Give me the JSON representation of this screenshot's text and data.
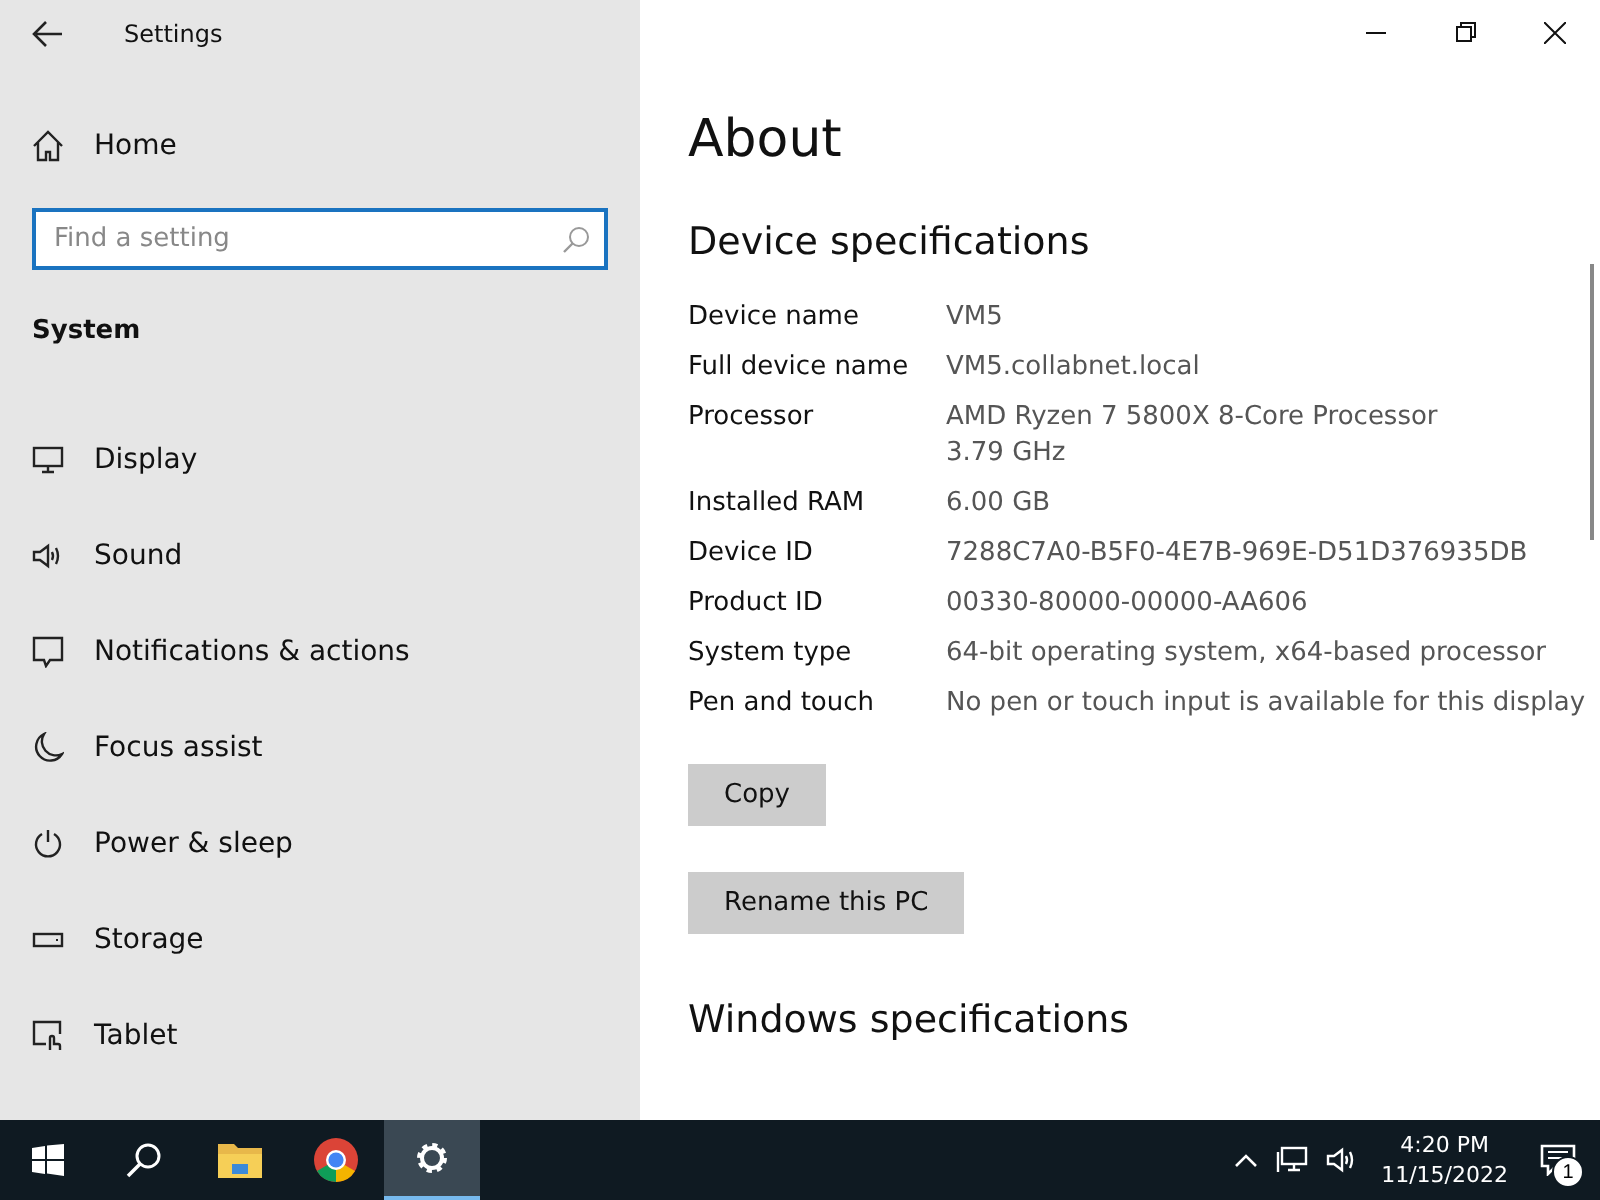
{
  "window": {
    "title": "Settings"
  },
  "sidebar": {
    "home": "Home",
    "search": {
      "placeholder": "Find a setting",
      "focused": true
    },
    "section": "System",
    "items": [
      {
        "label": "Display",
        "kind": "display"
      },
      {
        "label": "Sound",
        "kind": "sound"
      },
      {
        "label": "Notifications & actions",
        "kind": "notifications"
      },
      {
        "label": "Focus assist",
        "kind": "moon"
      },
      {
        "label": "Power & sleep",
        "kind": "power"
      },
      {
        "label": "Storage",
        "kind": "storage"
      },
      {
        "label": "Tablet",
        "kind": "tablet"
      }
    ]
  },
  "main": {
    "title": "About",
    "sections": [
      {
        "title": "Device specifications",
        "specs": [
          {
            "label": "Device name",
            "value": "VM5"
          },
          {
            "label": "Full device name",
            "value": "VM5.collabnet.local"
          },
          {
            "label": "Processor",
            "value": "AMD Ryzen 7 5800X 8-Core Processor",
            "value_2": "3.79 GHz"
          },
          {
            "label": "Installed RAM",
            "value": "6.00 GB"
          },
          {
            "label": "Device ID",
            "value": "7288C7A0-B5F0-4E7B-969E-D51D376935DB"
          },
          {
            "label": "Product ID",
            "value": "00330-80000-00000-AA606"
          },
          {
            "label": "System type",
            "value": "64-bit operating system, x64-based processor"
          },
          {
            "label": "Pen and touch",
            "value": "No pen or touch input is available for this display"
          }
        ],
        "buttons": [
          "Copy",
          "Rename this PC"
        ]
      },
      {
        "title": "Windows specifications"
      }
    ]
  },
  "taskbar": {
    "apps": [
      {
        "kind": "search",
        "selected": false
      },
      {
        "kind": "folder",
        "selected": false
      },
      {
        "kind": "browser",
        "selected": false
      },
      {
        "kind": "settings",
        "selected": true
      }
    ],
    "time": "4:20 PM",
    "date": "11/15/2022",
    "notification_count": "1"
  }
}
